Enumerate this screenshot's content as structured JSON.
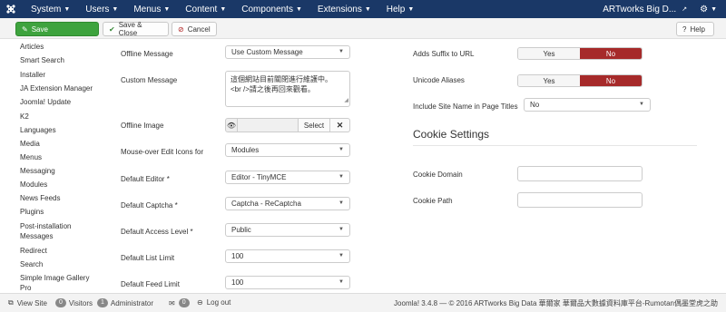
{
  "navbar": {
    "menu": [
      {
        "label": "System"
      },
      {
        "label": "Users"
      },
      {
        "label": "Menus"
      },
      {
        "label": "Content"
      },
      {
        "label": "Components"
      },
      {
        "label": "Extensions"
      },
      {
        "label": "Help"
      }
    ],
    "site_name": "ARTworks Big D..."
  },
  "toolbar": {
    "save_label": "Save",
    "save_close_label": "Save & Close",
    "cancel_label": "Cancel",
    "help_label": "Help"
  },
  "sidebar": {
    "items": [
      {
        "label": "Articles"
      },
      {
        "label": "Smart Search"
      },
      {
        "label": "Installer"
      },
      {
        "label": "JA Extension Manager"
      },
      {
        "label": "Joomla! Update"
      },
      {
        "label": "K2"
      },
      {
        "label": "Languages"
      },
      {
        "label": "Media"
      },
      {
        "label": "Menus"
      },
      {
        "label": "Messaging"
      },
      {
        "label": "Modules"
      },
      {
        "label": "News Feeds"
      },
      {
        "label": "Plugins"
      },
      {
        "label": "Post-installation"
      },
      {
        "label": "Messages"
      },
      {
        "label": "Redirect"
      },
      {
        "label": "Search"
      },
      {
        "label": "Simple Image Gallery"
      },
      {
        "label": "Pro"
      }
    ]
  },
  "form": {
    "offline_message": {
      "label": "Offline Message",
      "value": "Use Custom Message"
    },
    "custom_message": {
      "label": "Custom Message",
      "line1": "這個網站目前關閉進行維護中。",
      "line2": "<br />請之後再回來觀看。"
    },
    "offline_image": {
      "label": "Offline Image",
      "select_label": "Select"
    },
    "mouseover_edit_icons": {
      "label": "Mouse-over Edit Icons for",
      "value": "Modules"
    },
    "default_editor": {
      "label": "Default Editor *",
      "value": "Editor - TinyMCE"
    },
    "default_captcha": {
      "label": "Default Captcha *",
      "value": "Captcha - ReCaptcha"
    },
    "default_access_level": {
      "label": "Default Access Level *",
      "value": "Public"
    },
    "default_list_limit": {
      "label": "Default List Limit",
      "value": "100"
    },
    "default_feed_limit": {
      "label": "Default Feed Limit",
      "value": "100"
    }
  },
  "seo": {
    "adds_suffix": {
      "label": "Adds Suffix to URL",
      "yes": "Yes",
      "no": "No",
      "selected": "No"
    },
    "unicode_aliases": {
      "label": "Unicode Aliases",
      "yes": "Yes",
      "no": "No",
      "selected": "No"
    },
    "site_name_in_titles": {
      "label": "Include Site Name in Page Titles",
      "value": "No"
    }
  },
  "cookie": {
    "title": "Cookie Settings",
    "domain_label": "Cookie Domain",
    "domain_value": "",
    "path_label": "Cookie Path",
    "path_value": ""
  },
  "footer": {
    "view_site": "View Site",
    "visitors_count": "0",
    "visitors_label": "Visitors",
    "admin_count": "1",
    "admin_label": "Administrator",
    "messages_count": "0",
    "logout": "Log out",
    "copyright": "Joomla! 3.4.8 — © 2016 ARTworks Big Data 華爾家 華爾品大數據資料庫平台-Rumotan偶墨堂虎之助"
  },
  "colors": {
    "navbar": "#1a3867",
    "save_button": "#3ea33e",
    "toggle_no_active": "#a62a2a"
  }
}
